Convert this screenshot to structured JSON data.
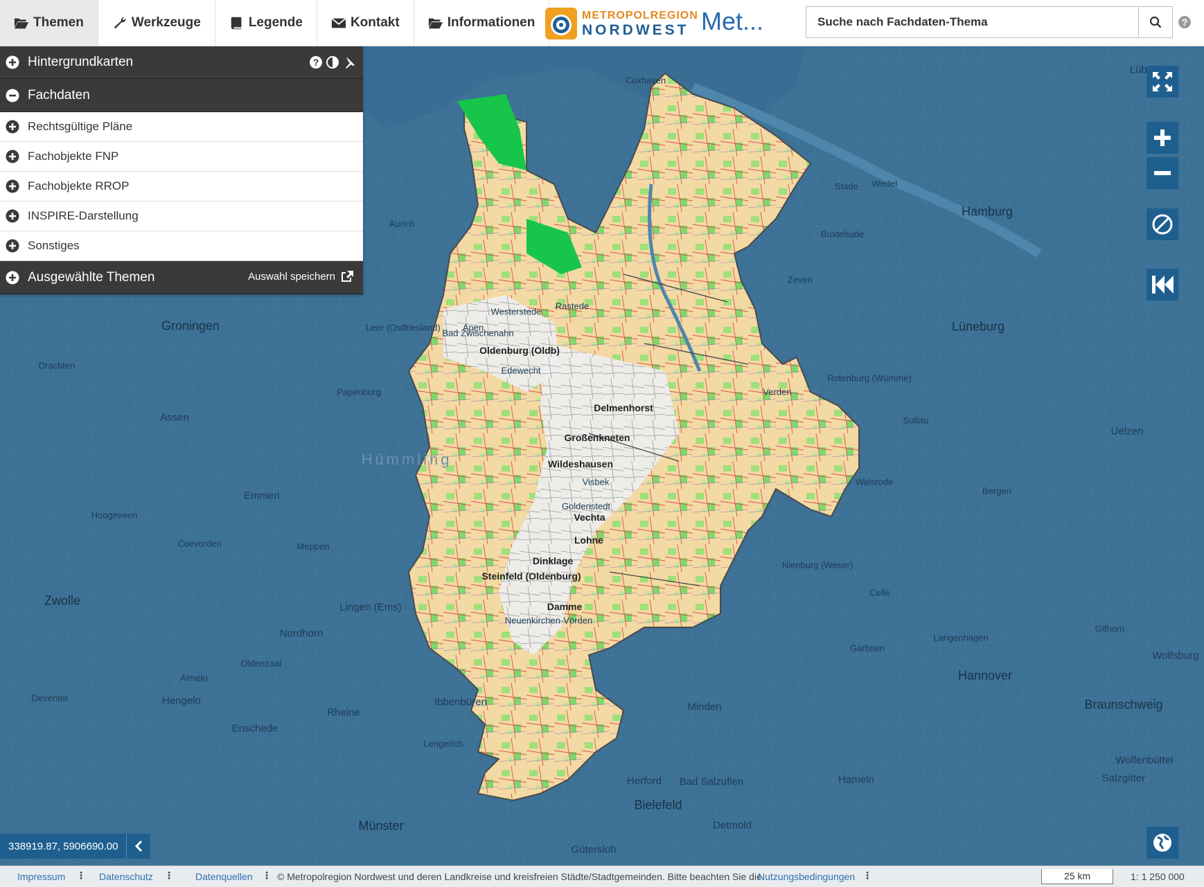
{
  "nav": {
    "items": [
      {
        "label": "Themen",
        "icon": "folder-open-icon",
        "active": true
      },
      {
        "label": "Werkzeuge",
        "icon": "wrench-icon",
        "active": false
      },
      {
        "label": "Legende",
        "icon": "book-icon",
        "active": false
      },
      {
        "label": "Kontakt",
        "icon": "envelope-icon",
        "active": false
      },
      {
        "label": "Informationen",
        "icon": "folder-open-icon",
        "active": false
      }
    ]
  },
  "logo": {
    "line1": "METROPOLREGION",
    "line2": "NORDWEST"
  },
  "site_title": "Met...",
  "search": {
    "placeholder": "Suche nach Fachdaten-Thema"
  },
  "panel": {
    "background_maps": "Hintergrundkarten",
    "fachdaten": "Fachdaten",
    "items": [
      "Rechtsgültige Pläne",
      "Fachobjekte FNP",
      "Fachobjekte RROP",
      "INSPIRE-Darstellung",
      "Sonstiges"
    ],
    "selected_themes": "Ausgewählte Themen",
    "save_selection": "Auswahl speichern"
  },
  "coordinates": "338919.87, 5906690.00",
  "footer": {
    "impressum": "Impressum",
    "datenschutz": "Datenschutz",
    "datenquellen": "Datenquellen",
    "copyright": "© Metropolregion Nordwest und deren Landkreise und kreisfreien Städte/Stadtgemeinden. Bitte beachten Sie die",
    "terms": "Nutzungsbedingungen",
    "scale_bar": "25 km",
    "scale": "1: 1 250 000"
  },
  "map": {
    "places_big": [
      "Hamburg",
      "Groningen",
      "Hannover",
      "Zwolle",
      "Bielefeld",
      "Braunschweig",
      "Lüneburg",
      "Münster",
      "Emmen",
      "Assen"
    ],
    "places": [
      "Lübeck",
      "Cuxhaven",
      "Wedel",
      "Stade",
      "Buxtehude",
      "Zeven",
      "Rotenburg (Wümme)",
      "Verden",
      "Soltau",
      "Walsrode",
      "Nienburg (Weser)",
      "Minden",
      "Herford",
      "Lingen (Ems)",
      "Nordhorn",
      "Meppen",
      "Aurich",
      "Leer (Ostfriesland)",
      "Westerstede",
      "Papenburg",
      "Hoogeveen",
      "Drachten",
      "Deventer",
      "Hengelo",
      "Enschede",
      "Rheine",
      "Ibbenbüren",
      "Lengerich",
      "Gütersloh",
      "Garbsen",
      "Langenhagen",
      "Wolfsburg",
      "Salzgitter",
      "Gifhorn",
      "Celle",
      "Uelzen",
      "Bergen",
      "Wolfenbüttel",
      "Hameln",
      "Detmold",
      "Bad Salzuflen",
      "Oldenzaal",
      "Almelo",
      "Coevorden"
    ],
    "places_dark": [
      "Oldenburg (Oldb)",
      "Delmenhorst",
      "Großenkneten",
      "Wildeshausen",
      "Vechta",
      "Dinklage",
      "Lohne",
      "Damme",
      "Visbek",
      "Goldenstedt",
      "Steinfeld (Oldenburg)",
      "Neuenkirchen-Vörden",
      "Bad Zwischenahn",
      "Edewecht",
      "Rastede",
      "Apen"
    ],
    "watermark": "Hümmling"
  }
}
